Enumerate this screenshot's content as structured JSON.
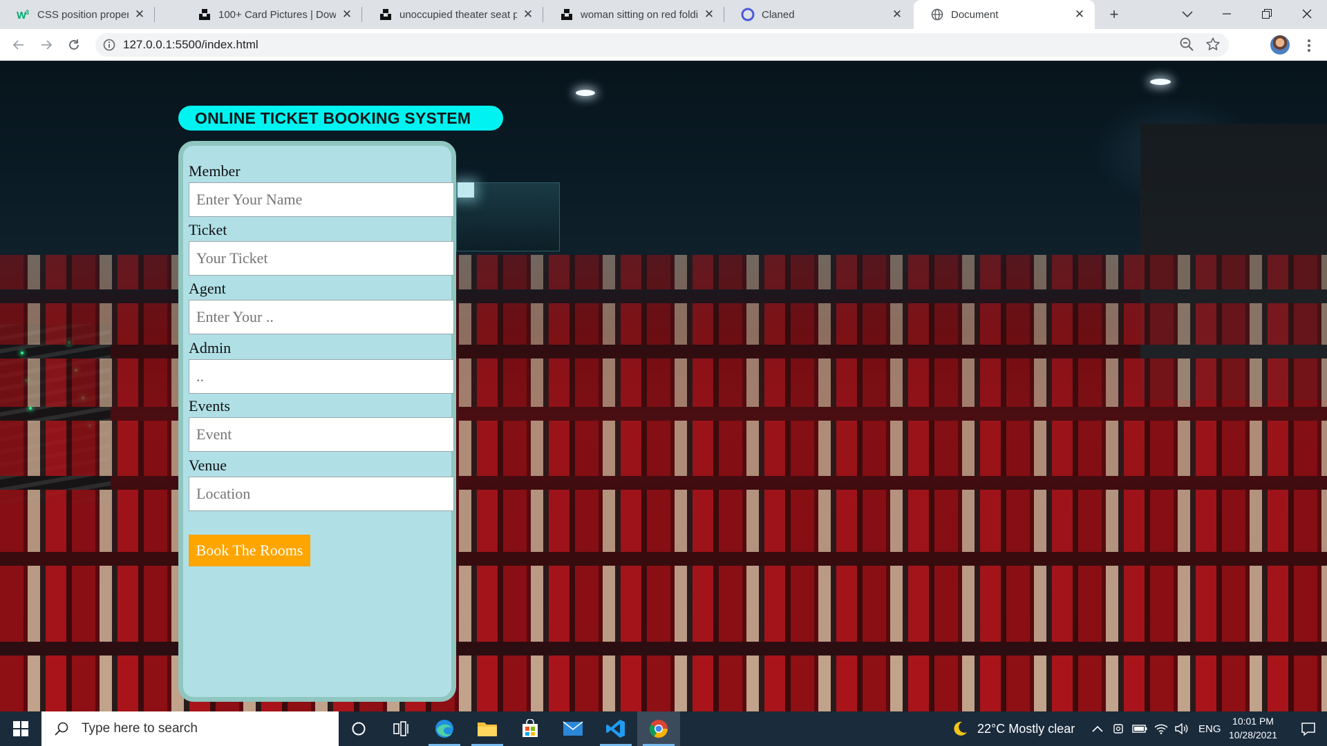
{
  "browser": {
    "tabs": [
      {
        "label": "CSS position property",
        "favicon": "w3schools-icon",
        "active": false
      },
      {
        "label": "100+ Card Pictures | Download",
        "favicon": "unsplash-icon",
        "active": false
      },
      {
        "label": "unoccupied theater seat photo",
        "favicon": "unsplash-icon",
        "active": false
      },
      {
        "label": "woman sitting on red folding",
        "favicon": "unsplash-icon",
        "active": false
      },
      {
        "label": "Claned",
        "favicon": "claned-icon",
        "active": false
      },
      {
        "label": "Document",
        "favicon": "globe-icon",
        "active": true
      }
    ],
    "url": "127.0.0.1:5500/index.html"
  },
  "page": {
    "title": "ONLINE TICKET BOOKING SYSTEM",
    "fields": [
      {
        "label": "Member",
        "placeholder": "Enter Your Name"
      },
      {
        "label": "Ticket",
        "placeholder": "Your Ticket"
      },
      {
        "label": "Agent",
        "placeholder": "Enter Your .."
      },
      {
        "label": "Admin",
        "placeholder": ".."
      },
      {
        "label": "Events",
        "placeholder": "Event"
      },
      {
        "label": "Venue",
        "placeholder": "Location"
      }
    ],
    "submit_label": "Book The Rooms",
    "colors": {
      "title_bg": "#00f3f0",
      "card_bg": "#b0e0e6",
      "button_bg": "#ffa500"
    }
  },
  "taskbar": {
    "search_placeholder": "Type here to search",
    "weather": "22°C  Mostly clear",
    "language": "ENG",
    "time": "10:01 PM",
    "date": "10/28/2021"
  }
}
